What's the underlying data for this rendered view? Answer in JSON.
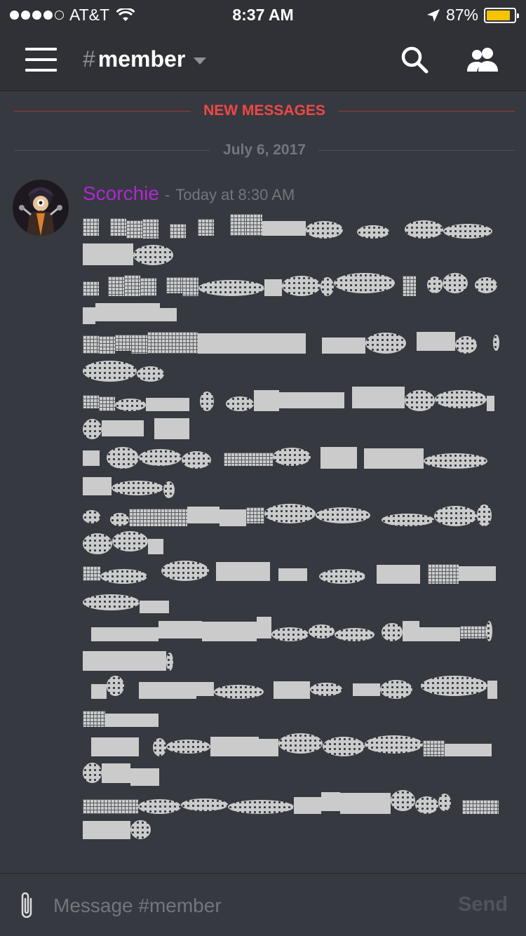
{
  "status_bar": {
    "carrier": "AT&T",
    "time": "8:37 AM",
    "battery_text": "87%",
    "battery_level": 0.87,
    "signal_icon": "signal-dots",
    "wifi_icon": "wifi-icon",
    "location_icon": "location-arrow-icon",
    "battery_color": "#f5c400"
  },
  "header": {
    "hash": "#",
    "channel_name": "member",
    "menu_icon": "hamburger-icon",
    "search_icon": "search-icon",
    "members_icon": "members-icon"
  },
  "divider_new": {
    "label": "NEW MESSAGES",
    "color": "#f04747"
  },
  "divider_date": {
    "label": "July 6, 2017"
  },
  "message": {
    "author": "Scorchie",
    "author_color": "#b027d4",
    "separator": "-",
    "timestamp": "Today at 8:30 AM",
    "content_note": "garbled"
  },
  "composer": {
    "placeholder": "Message #member",
    "send_label": "Send",
    "attach_icon": "paperclip-icon"
  }
}
